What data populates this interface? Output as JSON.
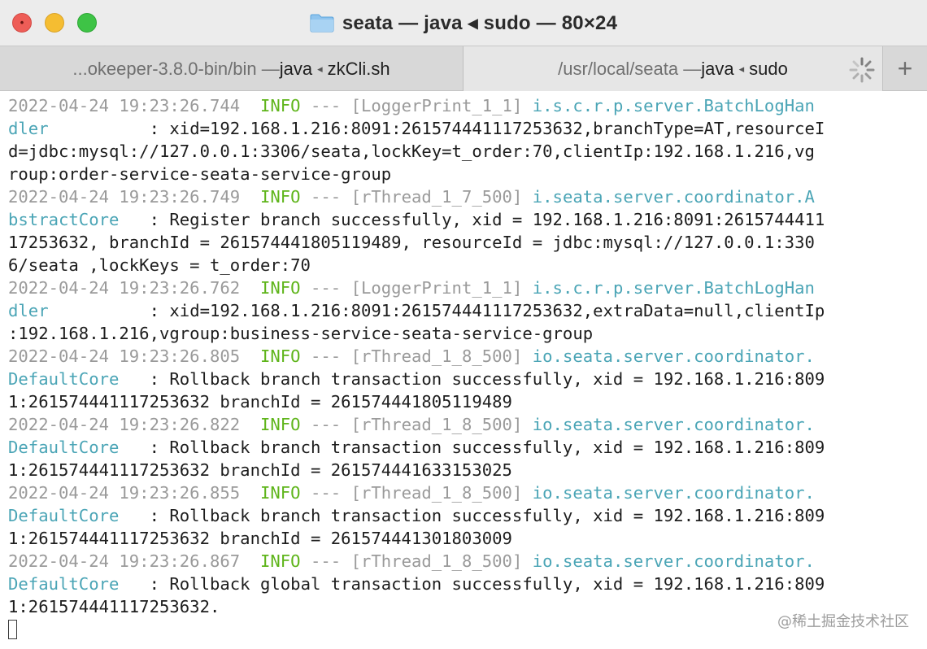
{
  "window": {
    "title": "seata — java ◂ sudo — 80×24",
    "folder_icon": "folder-icon",
    "traffic_lights": {
      "close_color": "#ee5d57",
      "minimize_color": "#f5bd32",
      "maximize_color": "#3ec346"
    }
  },
  "tabs": [
    {
      "path": "...okeeper-3.8.0-bin/bin — ",
      "process": "java",
      "separator": "◂",
      "command": "zkCli.sh",
      "active": false
    },
    {
      "path": "/usr/local/seata — ",
      "process": "java",
      "separator": "◂",
      "command": "sudo",
      "active": true
    }
  ],
  "new_tab_label": "+",
  "terminal": {
    "lines": [
      [
        {
          "t": "2022-04-24 19:23:26.744  ",
          "c": "ts"
        },
        {
          "t": "INFO",
          "c": "lvl"
        },
        {
          "t": " --- [LoggerPrint_1_1] ",
          "c": "dim"
        },
        {
          "t": "i.s.c.r.p.server.BatchLogHan",
          "c": "logger"
        }
      ],
      [
        {
          "t": "dler",
          "c": "logger"
        },
        {
          "t": "          : xid=192.168.1.216:8091:261574441117253632,branchType=AT,resourceI",
          "c": "text"
        }
      ],
      [
        {
          "t": "d=jdbc:mysql://127.0.0.1:3306/seata,lockKey=t_order:70,clientIp:192.168.1.216,vg",
          "c": "text"
        }
      ],
      [
        {
          "t": "roup:order-service-seata-service-group",
          "c": "text"
        }
      ],
      [
        {
          "t": "2022-04-24 19:23:26.749  ",
          "c": "ts"
        },
        {
          "t": "INFO",
          "c": "lvl"
        },
        {
          "t": " --- [rThread_1_7_500] ",
          "c": "dim"
        },
        {
          "t": "i.seata.server.coordinator.A",
          "c": "logger"
        }
      ],
      [
        {
          "t": "bstractCore",
          "c": "logger"
        },
        {
          "t": "   : Register branch successfully, xid = 192.168.1.216:8091:2615744411",
          "c": "text"
        }
      ],
      [
        {
          "t": "17253632, branchId = 261574441805119489, resourceId = jdbc:mysql://127.0.0.1:330",
          "c": "text"
        }
      ],
      [
        {
          "t": "6/seata ,lockKeys = t_order:70",
          "c": "text"
        }
      ],
      [
        {
          "t": "2022-04-24 19:23:26.762  ",
          "c": "ts"
        },
        {
          "t": "INFO",
          "c": "lvl"
        },
        {
          "t": " --- [LoggerPrint_1_1] ",
          "c": "dim"
        },
        {
          "t": "i.s.c.r.p.server.BatchLogHan",
          "c": "logger"
        }
      ],
      [
        {
          "t": "dler",
          "c": "logger"
        },
        {
          "t": "          : xid=192.168.1.216:8091:261574441117253632,extraData=null,clientIp",
          "c": "text"
        }
      ],
      [
        {
          "t": ":192.168.1.216,vgroup:business-service-seata-service-group",
          "c": "text"
        }
      ],
      [
        {
          "t": "2022-04-24 19:23:26.805  ",
          "c": "ts"
        },
        {
          "t": "INFO",
          "c": "lvl"
        },
        {
          "t": " --- [rThread_1_8_500] ",
          "c": "dim"
        },
        {
          "t": "io.seata.server.coordinator.",
          "c": "logger"
        }
      ],
      [
        {
          "t": "DefaultCore",
          "c": "logger"
        },
        {
          "t": "   : Rollback branch transaction successfully, xid = 192.168.1.216:809",
          "c": "text"
        }
      ],
      [
        {
          "t": "1:261574441117253632 branchId = 261574441805119489",
          "c": "text"
        }
      ],
      [
        {
          "t": "2022-04-24 19:23:26.822  ",
          "c": "ts"
        },
        {
          "t": "INFO",
          "c": "lvl"
        },
        {
          "t": " --- [rThread_1_8_500] ",
          "c": "dim"
        },
        {
          "t": "io.seata.server.coordinator.",
          "c": "logger"
        }
      ],
      [
        {
          "t": "DefaultCore",
          "c": "logger"
        },
        {
          "t": "   : Rollback branch transaction successfully, xid = 192.168.1.216:809",
          "c": "text"
        }
      ],
      [
        {
          "t": "1:261574441117253632 branchId = 261574441633153025",
          "c": "text"
        }
      ],
      [
        {
          "t": "2022-04-24 19:23:26.855  ",
          "c": "ts"
        },
        {
          "t": "INFO",
          "c": "lvl"
        },
        {
          "t": " --- [rThread_1_8_500] ",
          "c": "dim"
        },
        {
          "t": "io.seata.server.coordinator.",
          "c": "logger"
        }
      ],
      [
        {
          "t": "DefaultCore",
          "c": "logger"
        },
        {
          "t": "   : Rollback branch transaction successfully, xid = 192.168.1.216:809",
          "c": "text"
        }
      ],
      [
        {
          "t": "1:261574441117253632 branchId = 261574441301803009",
          "c": "text"
        }
      ],
      [
        {
          "t": "2022-04-24 19:23:26.867  ",
          "c": "ts"
        },
        {
          "t": "INFO",
          "c": "lvl"
        },
        {
          "t": " --- [rThread_1_8_500] ",
          "c": "dim"
        },
        {
          "t": "io.seata.server.coordinator.",
          "c": "logger"
        }
      ],
      [
        {
          "t": "DefaultCore",
          "c": "logger"
        },
        {
          "t": "   : Rollback global transaction successfully, xid = 192.168.1.216:809",
          "c": "text"
        }
      ],
      [
        {
          "t": "1:261574441117253632.",
          "c": "text"
        }
      ]
    ],
    "colors": {
      "timestamp": "#9a9a9a",
      "level": "#5fb51b",
      "logger": "#4ba5b6",
      "text": "#1d1d1d"
    }
  },
  "watermark": "@稀土掘金技术社区"
}
